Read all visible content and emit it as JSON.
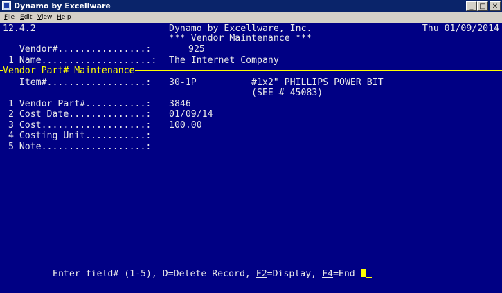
{
  "window": {
    "title": "Dynamo by Excellware",
    "buttons": {
      "minimize": "_",
      "maximize": "□",
      "close": "✕"
    }
  },
  "menu": {
    "file": {
      "accel": "F",
      "rest": "ile"
    },
    "edit": {
      "accel": "E",
      "rest": "dit"
    },
    "view": {
      "accel": "V",
      "rest": "iew"
    },
    "help": {
      "accel": "H",
      "rest": "elp"
    }
  },
  "header": {
    "version": "12.4.2",
    "company": "Dynamo by Excellware, Inc.",
    "date": "Thu 01/09/2014",
    "screen_title": "*** Vendor Maintenance ***"
  },
  "vendor": {
    "number_label": "   Vendor#................:",
    "number_value": "925",
    "name_label": " 1 Name....................:",
    "name_value": "The Internet Company"
  },
  "section": {
    "title": "Vendor Part# Maintenance"
  },
  "item": {
    "label": "   Item#..................:",
    "value": "30-1P",
    "description_1": "#1x2\" PHILLIPS POWER BIT",
    "description_2": "(SEE # 45083)"
  },
  "fields": {
    "f1": {
      "label": " 1 Vendor Part#...........:",
      "value": "3846"
    },
    "f2": {
      "label": " 2 Cost Date..............:",
      "value": "01/09/14"
    },
    "f3": {
      "label": " 3 Cost...................:",
      "value": "100.00"
    },
    "f4": {
      "label": " 4 Costing Unit...........:",
      "value": ""
    },
    "f5": {
      "label": " 5 Note...................:",
      "value": ""
    }
  },
  "prompt": {
    "part1": "Enter field# (1-5), D=Delete Record, ",
    "f2_key": "F2",
    "part2": "=Display, ",
    "f4_key": "F4",
    "part3": "=End "
  },
  "colors": {
    "terminal_bg": "#000084",
    "text": "#e8e8e8",
    "highlight": "#ffff00",
    "titlebar": "#0a246a"
  }
}
